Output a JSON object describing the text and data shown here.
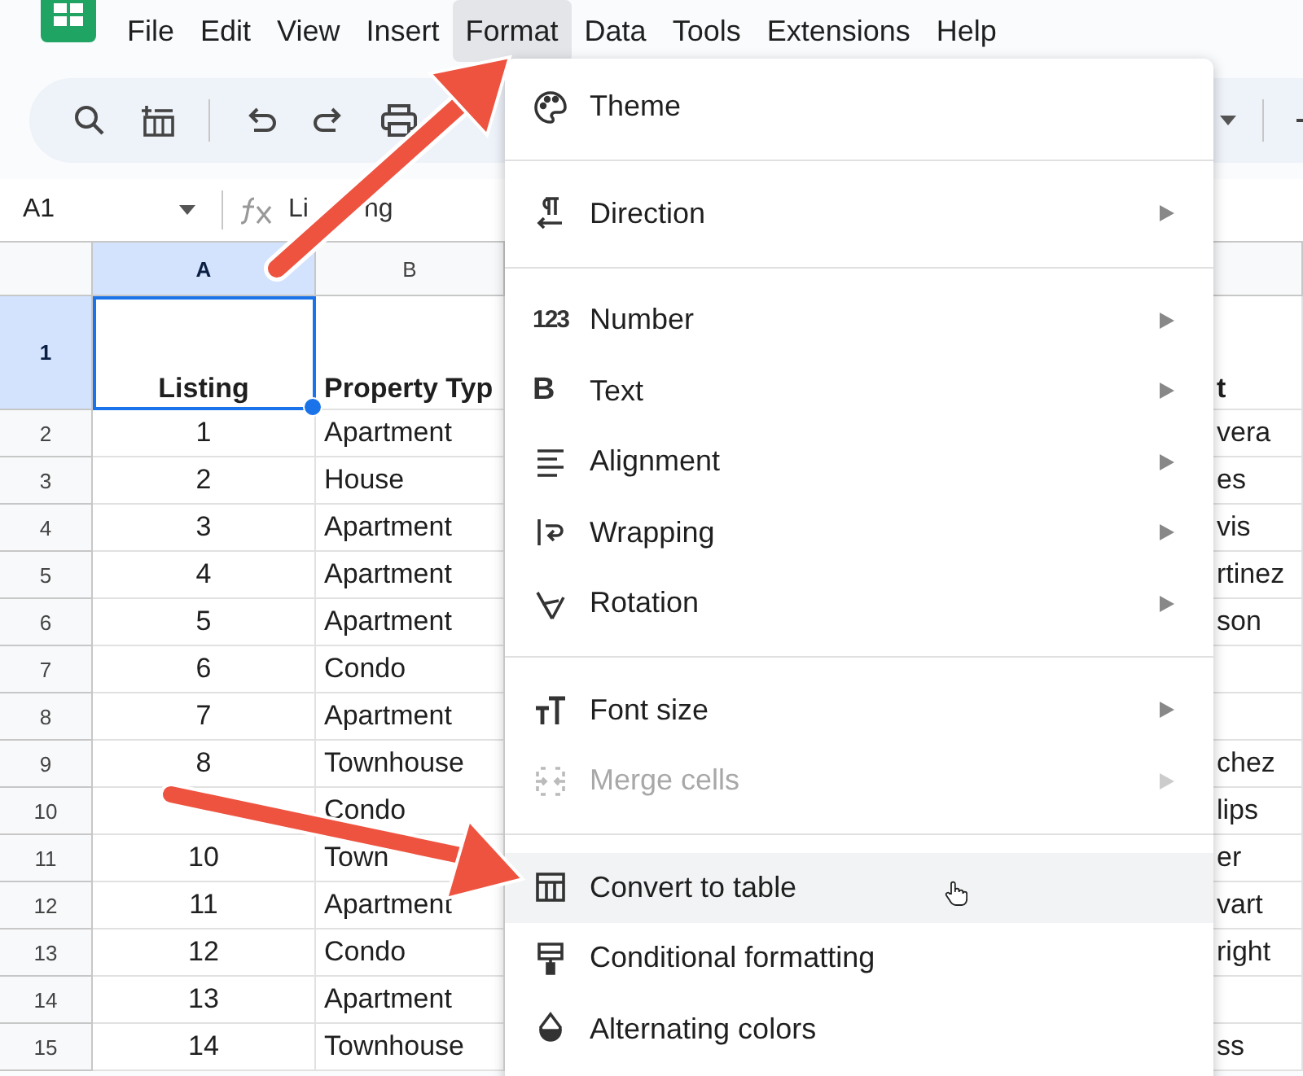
{
  "menubar": [
    {
      "label": "File",
      "selected": false
    },
    {
      "label": "Edit",
      "selected": false
    },
    {
      "label": "View",
      "selected": false
    },
    {
      "label": "Insert",
      "selected": false
    },
    {
      "label": "Format",
      "selected": true
    },
    {
      "label": "Data",
      "selected": false
    },
    {
      "label": "Tools",
      "selected": false
    },
    {
      "label": "Extensions",
      "selected": false
    },
    {
      "label": "Help",
      "selected": false
    }
  ],
  "formula_bar": {
    "cell_ref": "A1",
    "value": "Li",
    "value_end": "ng"
  },
  "columns": [
    {
      "label": "A",
      "selected": true
    },
    {
      "label": "B",
      "selected": false
    }
  ],
  "rows": [
    {
      "row": "1",
      "selected": true,
      "listing": "Listing",
      "property_type": "Property Typ",
      "last_column": "t"
    },
    {
      "row": "2",
      "selected": false,
      "listing": "1",
      "property_type": "Apartment",
      "last_column": "vera"
    },
    {
      "row": "3",
      "selected": false,
      "listing": "2",
      "property_type": "House",
      "last_column": "es"
    },
    {
      "row": "4",
      "selected": false,
      "listing": "3",
      "property_type": "Apartment",
      "last_column": "vis"
    },
    {
      "row": "5",
      "selected": false,
      "listing": "4",
      "property_type": "Apartment",
      "last_column": "rtinez"
    },
    {
      "row": "6",
      "selected": false,
      "listing": "5",
      "property_type": "Apartment",
      "last_column": "son"
    },
    {
      "row": "7",
      "selected": false,
      "listing": "6",
      "property_type": "Condo"
    },
    {
      "row": "8",
      "selected": false,
      "listing": "7",
      "property_type": "Apartment"
    },
    {
      "row": "9",
      "selected": false,
      "listing": "8",
      "property_type": "Townhouse",
      "last_column": "chez"
    },
    {
      "row": "10",
      "selected": false,
      "property_type": "Condo",
      "last_column": "lips"
    },
    {
      "row": "11",
      "selected": false,
      "listing": "10",
      "property_type": "Town",
      "last_column": "er"
    },
    {
      "row": "12",
      "selected": false,
      "listing": "11",
      "property_type": "Apartment",
      "last_column": "vart"
    },
    {
      "row": "13",
      "selected": false,
      "listing": "12",
      "property_type": "Condo",
      "last_column": "right"
    },
    {
      "row": "14",
      "selected": false,
      "listing": "13",
      "property_type": "Apartment"
    },
    {
      "row": "15",
      "selected": false,
      "listing": "14",
      "property_type": "Townhouse",
      "last_column": "ss"
    }
  ],
  "format_menu": {
    "sections": [
      {
        "items": [
          {
            "label": "Theme",
            "submenu": false,
            "disabled": false,
            "highlighted": false
          }
        ]
      },
      {
        "items": [
          {
            "label": "Direction",
            "submenu": true,
            "disabled": false,
            "highlighted": false
          }
        ]
      },
      {
        "items": [
          {
            "label": "Number",
            "icon_text": "123",
            "submenu": true,
            "disabled": false,
            "highlighted": false
          },
          {
            "label": "Text",
            "icon_text": "B",
            "submenu": true,
            "disabled": false,
            "highlighted": false
          },
          {
            "label": "Alignment",
            "submenu": true,
            "disabled": false,
            "highlighted": false
          },
          {
            "label": "Wrapping",
            "submenu": true,
            "disabled": false,
            "highlighted": false
          },
          {
            "label": "Rotation",
            "submenu": true,
            "disabled": false,
            "highlighted": false
          }
        ]
      },
      {
        "items": [
          {
            "label": "Font size",
            "submenu": true,
            "disabled": false,
            "highlighted": false
          },
          {
            "label": "Merge cells",
            "submenu": true,
            "disabled": true,
            "highlighted": false
          }
        ]
      },
      {
        "items": [
          {
            "label": "Convert to table",
            "submenu": false,
            "disabled": false,
            "highlighted": true
          },
          {
            "label": "Conditional formatting",
            "submenu": false,
            "disabled": false,
            "highlighted": false
          },
          {
            "label": "Alternating colors",
            "submenu": false,
            "disabled": false,
            "highlighted": false
          }
        ]
      }
    ]
  }
}
